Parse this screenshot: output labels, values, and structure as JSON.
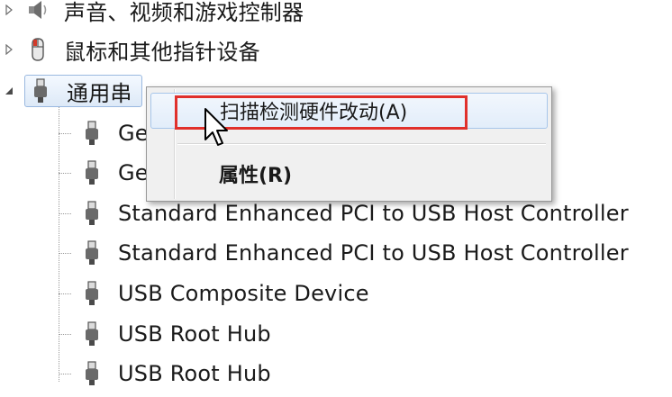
{
  "tree": {
    "categories": [
      {
        "label": "声音、视频和游戏控制器",
        "expanded": false,
        "icon": "speaker-icon"
      },
      {
        "label": "鼠标和其他指针设备",
        "expanded": false,
        "icon": "mouse-icon"
      },
      {
        "label": "通用串行总线控制器",
        "expanded": true,
        "icon": "usb-plug-icon",
        "selected": true
      }
    ],
    "usb_children": [
      {
        "label": "Ge",
        "icon": "usb-plug-icon"
      },
      {
        "label": "Ge",
        "icon": "usb-plug-icon"
      },
      {
        "label": "Standard Enhanced PCI to USB Host Controller",
        "icon": "usb-plug-icon"
      },
      {
        "label": "Standard Enhanced PCI to USB Host Controller",
        "icon": "usb-plug-icon"
      },
      {
        "label": "USB Composite Device",
        "icon": "usb-plug-icon"
      },
      {
        "label": "USB Root Hub",
        "icon": "usb-plug-icon"
      },
      {
        "label": "USB Root Hub",
        "icon": "usb-plug-icon"
      }
    ],
    "selected_visible_label": "通用串"
  },
  "context_menu": {
    "items": [
      {
        "label": "扫描检测硬件改动(A)",
        "highlighted": true
      },
      {
        "label": "属性(R)",
        "bold": true
      }
    ]
  },
  "annotation": {
    "highlight_color": "#e0302c"
  },
  "colors": {
    "selection_border": "#9ab9e0",
    "menu_bg": "#f0f0f0"
  }
}
